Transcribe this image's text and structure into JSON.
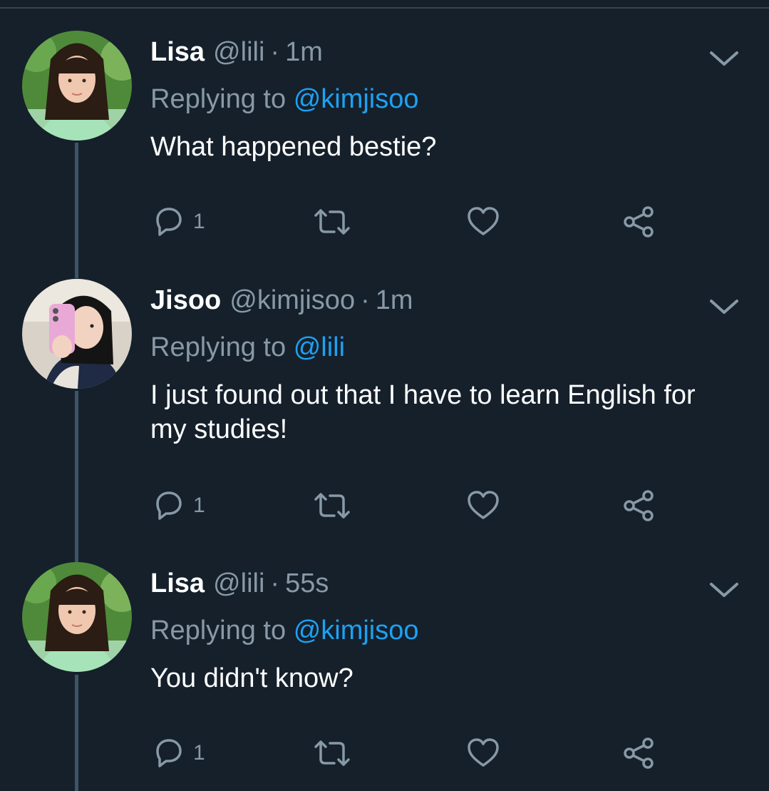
{
  "thread": {
    "tweets": [
      {
        "name": "Lisa",
        "handle": "@lili",
        "separator": "·",
        "time": "1m",
        "replying_prefix": "Replying to",
        "replying_to": "@kimjisoo",
        "text": "What happened bestie?",
        "reply_count": "1"
      },
      {
        "name": "Jisoo",
        "handle": "@kimjisoo",
        "separator": "·",
        "time": "1m",
        "replying_prefix": "Replying to",
        "replying_to": "@lili",
        "text": "I just found out that I have to learn English for my studies!",
        "reply_count": "1"
      },
      {
        "name": "Lisa",
        "handle": "@lili",
        "separator": "·",
        "time": "55s",
        "replying_prefix": "Replying to",
        "replying_to": "@kimjisoo",
        "text": "You didn't know?",
        "reply_count": "1"
      }
    ]
  },
  "icons": {
    "reply": "reply-icon",
    "retweet": "retweet-icon",
    "like": "heart-icon",
    "share": "share-icon",
    "more": "chevron-down-icon"
  },
  "colors": {
    "background": "#15202b",
    "name": "#ffffff",
    "secondary": "#8899a6",
    "mention": "#1da1f2",
    "thread_line": "#3d5466"
  }
}
